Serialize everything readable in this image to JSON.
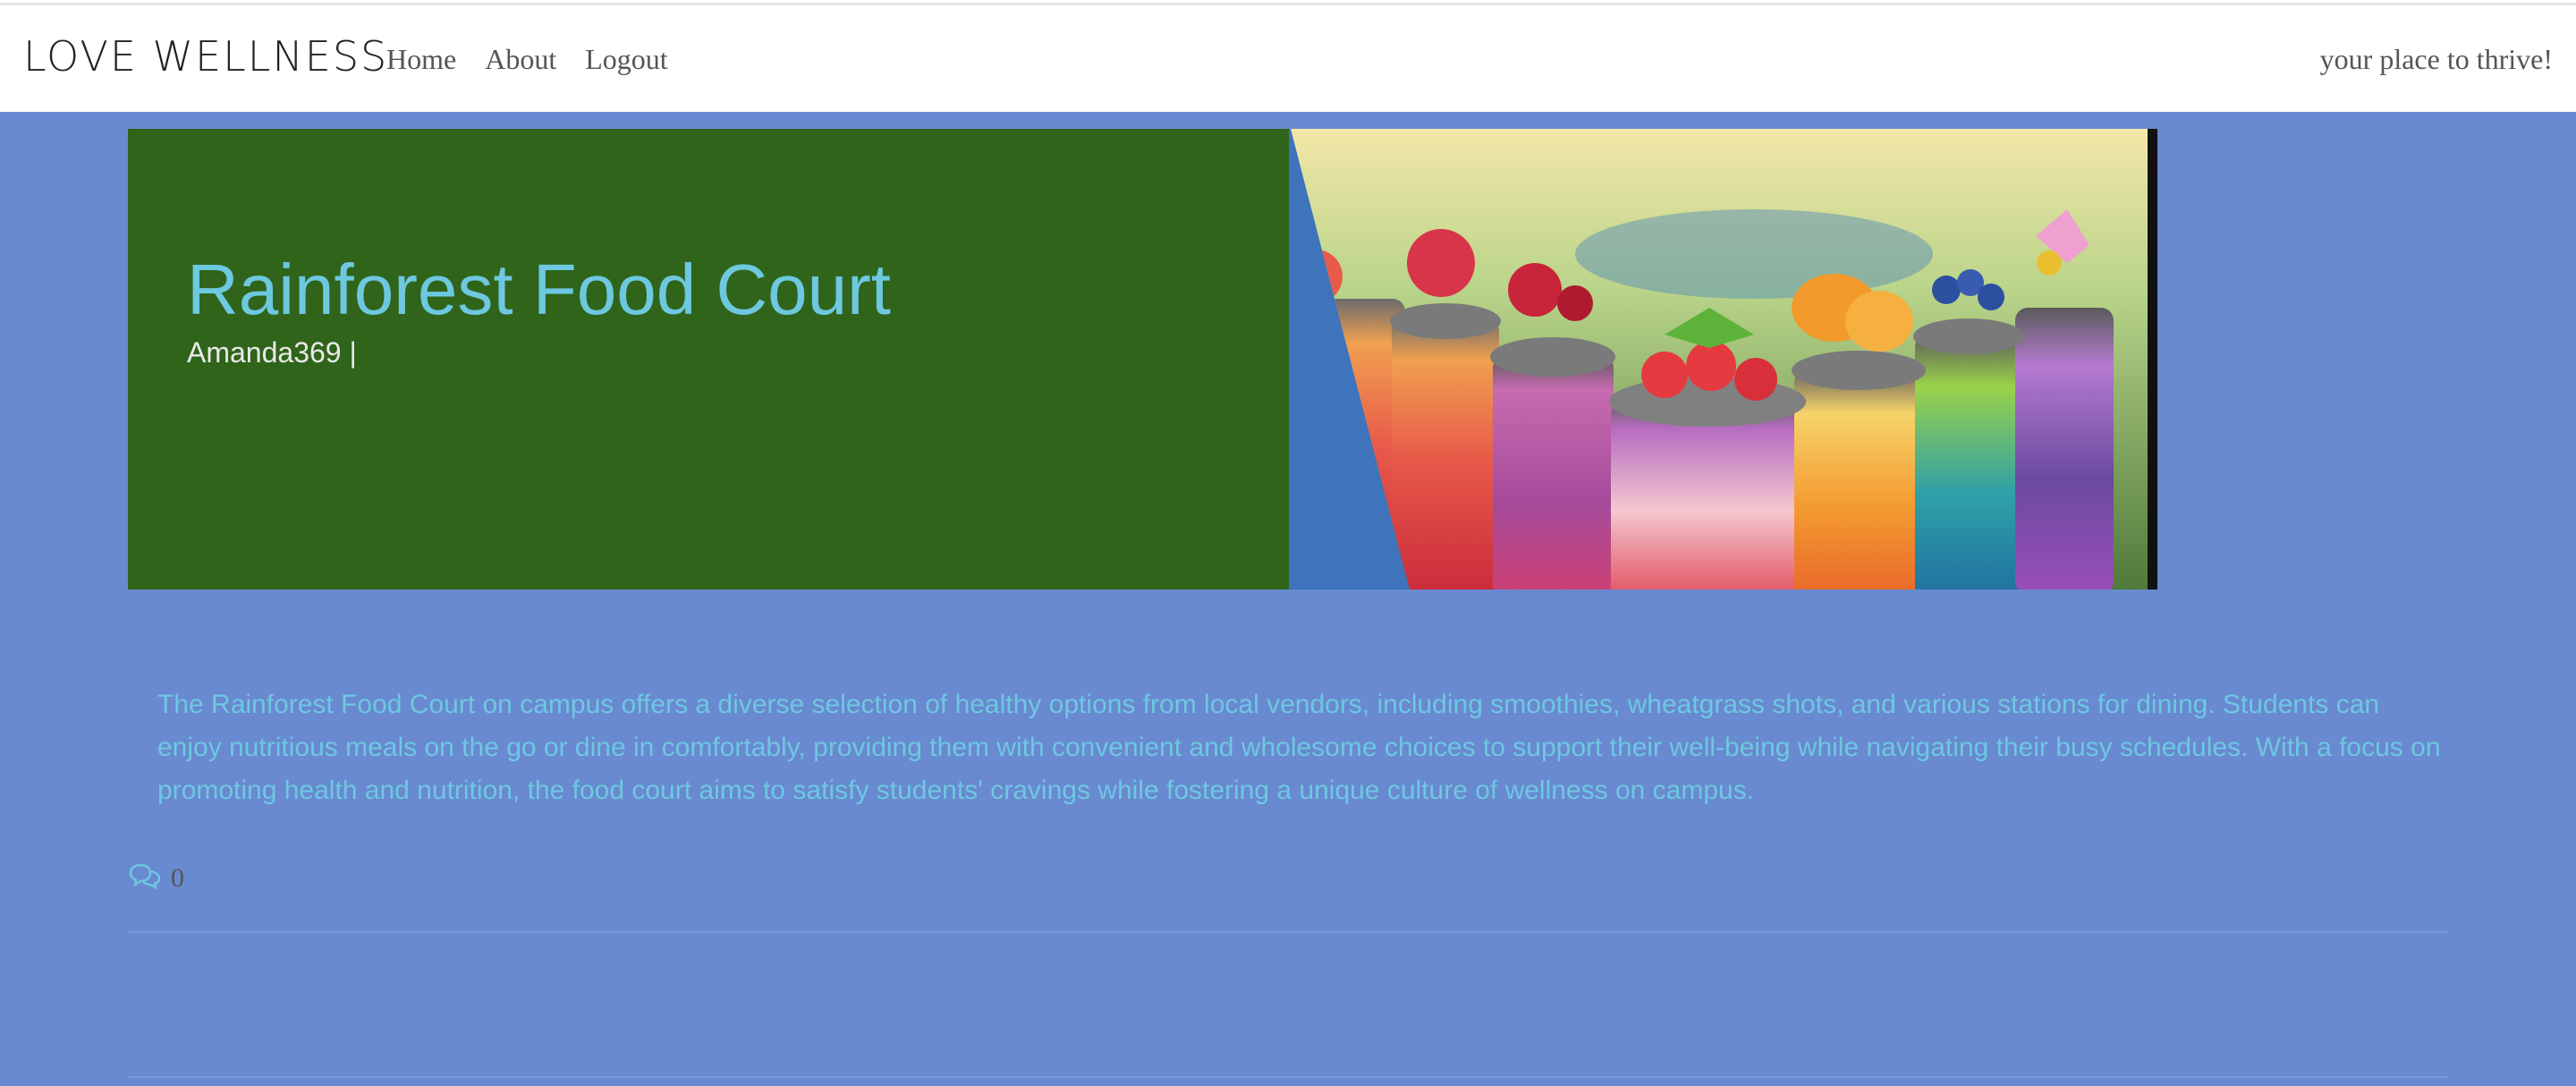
{
  "navbar": {
    "brand": "LOVE WELLNESS",
    "links": [
      "Home",
      "About",
      "Logout"
    ],
    "tagline": "your place to thrive!"
  },
  "post": {
    "title": "Rainforest Food Court",
    "author": "Amanda369 |",
    "image_alt": "layered fruit smoothie cups topped with berries and mint",
    "description": "The Rainforest Food Court on campus offers a diverse selection of healthy options from local vendors, including smoothies, wheatgrass shots, and various stations for dining. Students can enjoy nutritious meals on the go or dine in comfortably, providing them with convenient and wholesome choices to support their well-being while navigating their busy schedules. With a focus on promoting health and nutrition, the food court aims to satisfy students' cravings while fostering a unique culture of wellness on campus.",
    "comment_count": "0",
    "comment_icon": "comments-icon"
  },
  "colors": {
    "page_background": "#6989d0",
    "hero_green": "#2f641a",
    "accent_teal": "#6dc8e0",
    "hero_blue": "#3f73bb"
  }
}
